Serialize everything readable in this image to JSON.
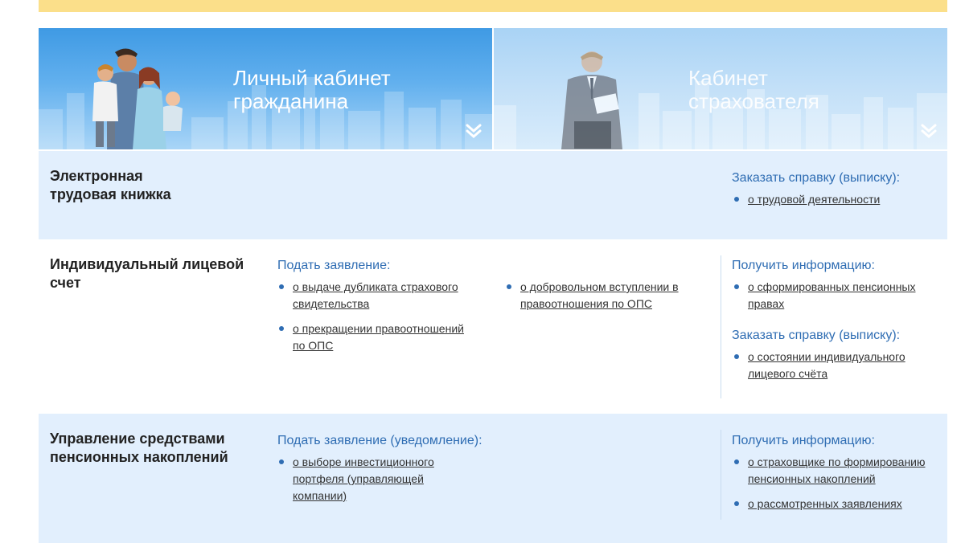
{
  "banners": {
    "citizen_title": "Личный кабинет\nгражданина",
    "insurer_title": "Кабинет\nстрахователя"
  },
  "sections": {
    "labor_book": {
      "title": "Электронная\nтрудовая книжка",
      "order_label": "Заказать справку (выписку):",
      "order_items": [
        "о трудовой деятельности"
      ]
    },
    "personal_account": {
      "title": "Индивидуальный лицевой\nсчет",
      "apply_label": "Подать заявление:",
      "apply_items": [
        "о выдаче дубликата страхового свидетельства",
        "о прекращении правоотношений по ОПС"
      ],
      "apply_items_col2": [
        "о добровольном вступлении в правоотношения по ОПС"
      ],
      "info_label": "Получить информацию:",
      "info_items": [
        "о сформированных пенсионных правах"
      ],
      "order_label": "Заказать справку (выписку):",
      "order_items": [
        "о состоянии индивидуального лицевого счёта"
      ]
    },
    "savings": {
      "title": "Управление средствами\nпенсионных накоплений",
      "apply_label": "Подать заявление (уведомление):",
      "apply_items": [
        "о выборе инвестиционного портфеля (управляющей компании)"
      ],
      "info_label": "Получить информацию:",
      "info_items": [
        "о страховщике по формированию пенсионных накоплений",
        "о рассмотренных заявлениях"
      ]
    }
  }
}
